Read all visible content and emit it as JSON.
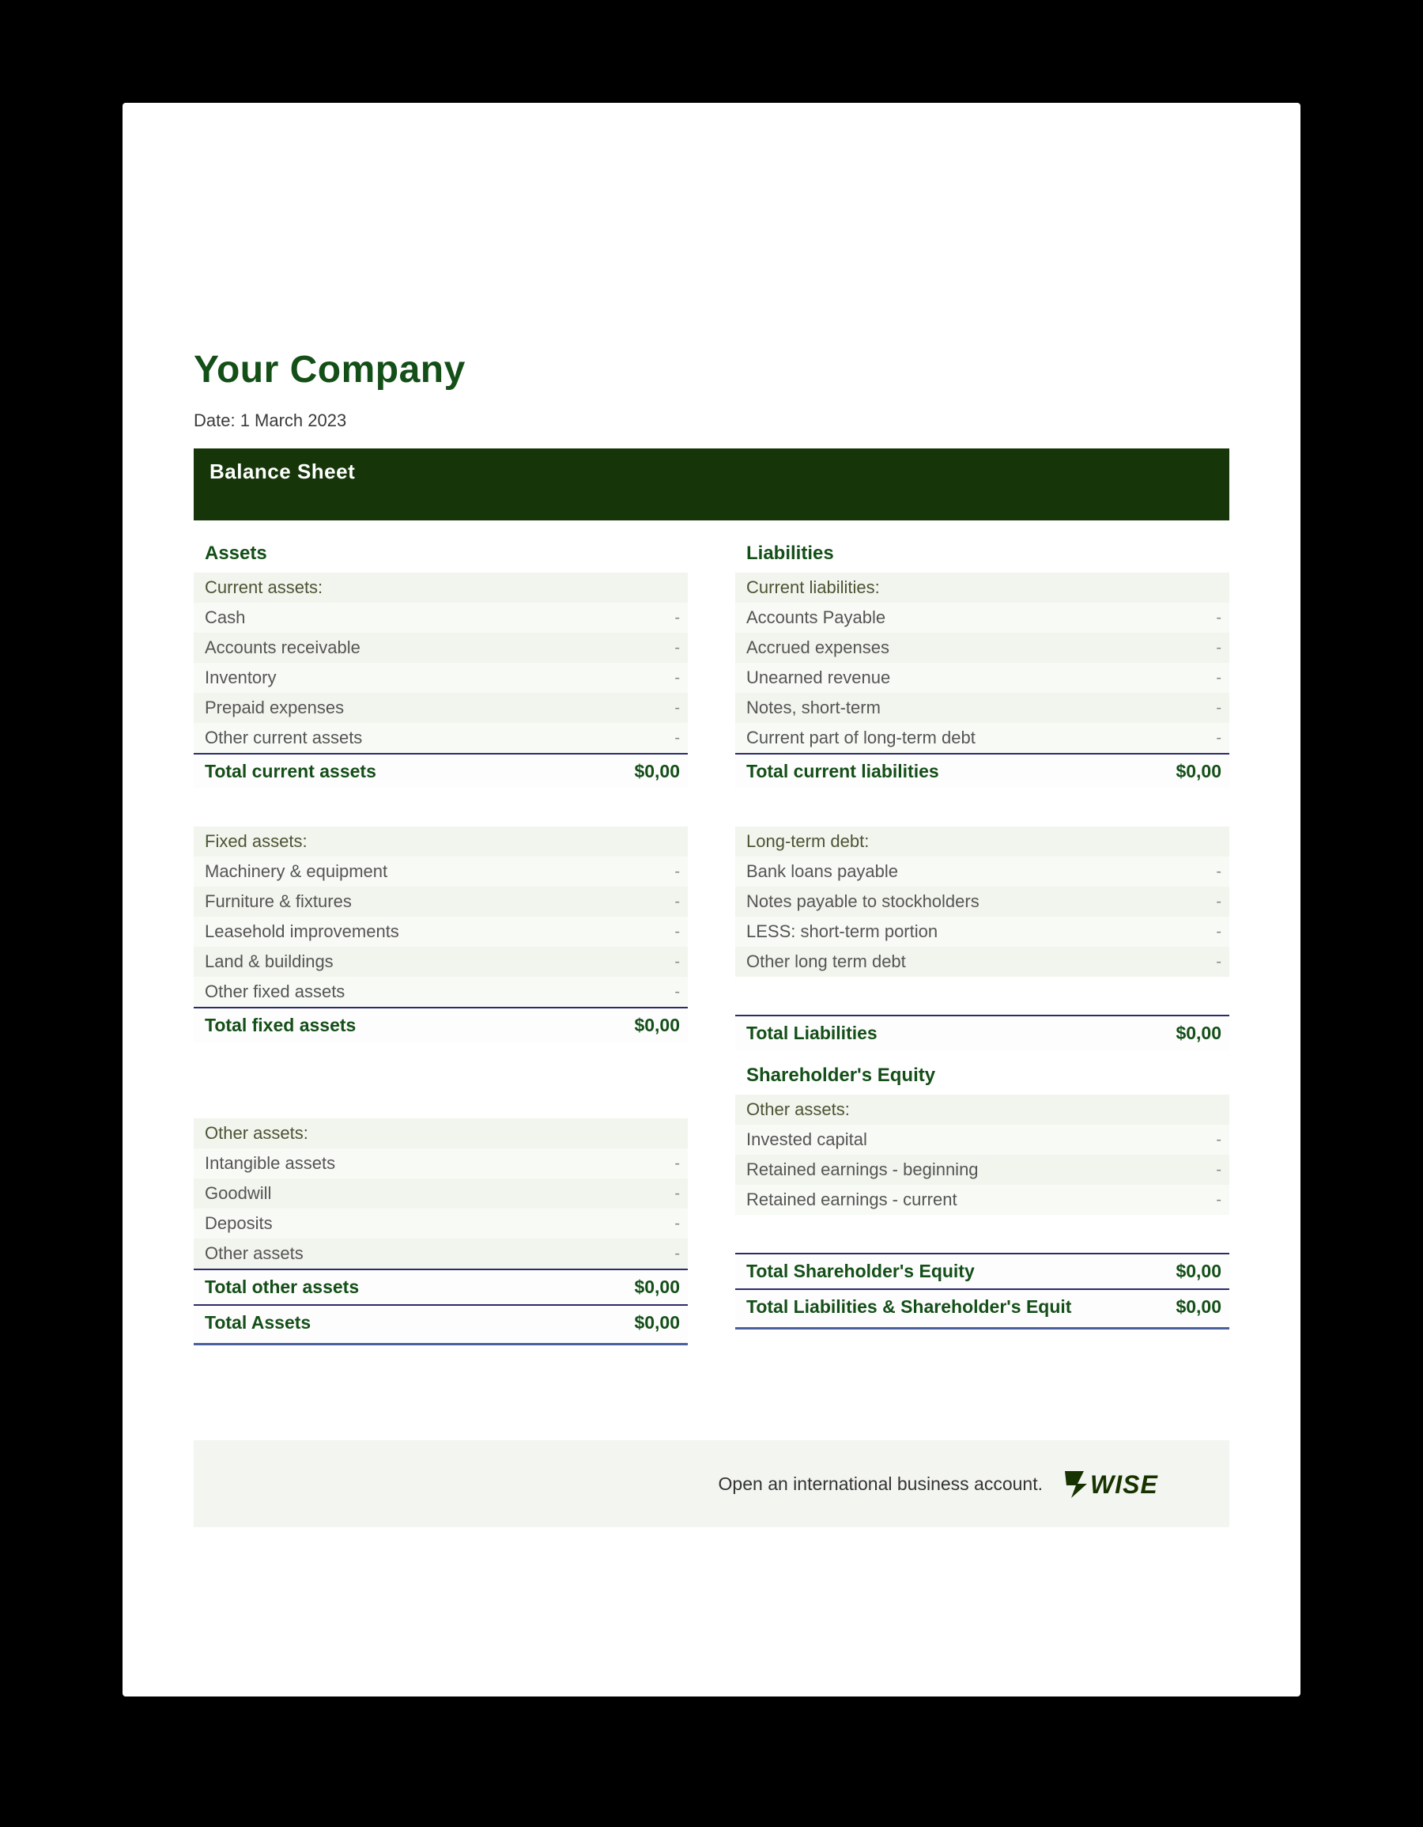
{
  "company_name": "Your Company",
  "date_label": "Date: 1 March 2023",
  "banner_label": "Balance Sheet",
  "assets_heading": "Assets",
  "liabilities_heading": "Liabilities",
  "equity_heading": "Shareholder's Equity",
  "currency_zero": "$0,00",
  "dash": "-",
  "assets": {
    "current_subhead": "Current assets:",
    "current_items": [
      "Cash",
      "Accounts receivable",
      "Inventory",
      "Prepaid expenses",
      "Other current assets"
    ],
    "current_total_label": "Total current assets",
    "fixed_subhead": "Fixed assets:",
    "fixed_items": [
      "Machinery & equipment",
      "Furniture & fixtures",
      "Leasehold improvements",
      "Land & buildings",
      "Other fixed assets"
    ],
    "fixed_total_label": "Total fixed assets",
    "other_subhead": "Other assets:",
    "other_items": [
      "Intangible assets",
      "Goodwill",
      "Deposits",
      "Other assets"
    ],
    "other_total_label": "Total other assets",
    "grand_total_label": "Total Assets"
  },
  "liabilities": {
    "current_subhead": "Current liabilities:",
    "current_items": [
      "Accounts Payable",
      "Accrued expenses",
      "Unearned revenue",
      "Notes, short-term",
      "Current part of long-term debt"
    ],
    "current_total_label": "Total current liabilities",
    "longterm_subhead": "Long-term debt:",
    "longterm_items": [
      "Bank loans payable",
      "Notes payable to stockholders",
      "LESS: short-term portion",
      "Other long term debt"
    ],
    "liabilities_total_label": "Total Liabilities"
  },
  "equity": {
    "subhead": "Other assets:",
    "items": [
      "Invested capital",
      "Retained earnings - beginning",
      "Retained earnings - current"
    ],
    "total_label": "Total Shareholder's Equity",
    "grand_total_label": "Total Liabilities & Shareholder's Equit"
  },
  "footer_text": "Open an international business account.",
  "logo_name": "WISE"
}
